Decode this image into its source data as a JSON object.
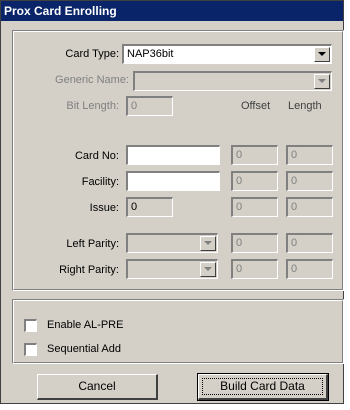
{
  "window": {
    "title": "Prox Card Enrolling"
  },
  "form": {
    "card_type": {
      "label": "Card Type:",
      "value": "NAP36bit"
    },
    "generic_name": {
      "label": "Generic Name:",
      "value": ""
    },
    "bit_length": {
      "label": "Bit Length:",
      "value": "0"
    },
    "columns": {
      "offset": "Offset",
      "length": "Length"
    },
    "rows": [
      {
        "label": "Card No:",
        "value": "",
        "offset": "0",
        "length": "0"
      },
      {
        "label": "Facility:",
        "value": "",
        "offset": "0",
        "length": "0"
      },
      {
        "label": "Issue:",
        "value": "0",
        "offset": "0",
        "length": "0"
      },
      {
        "label": "Left Parity:",
        "value": "",
        "offset": "0",
        "length": "0"
      },
      {
        "label": "Right Parity:",
        "value": "",
        "offset": "0",
        "length": "0"
      }
    ]
  },
  "options": {
    "enable_alpre": {
      "label": "Enable AL-PRE",
      "checked": false
    },
    "sequential_add": {
      "label": "Sequential Add",
      "checked": false
    }
  },
  "buttons": {
    "cancel": "Cancel",
    "build": "Build Card Data"
  },
  "colors": {
    "title_bg": "#0a246a",
    "face": "#d4d0c8",
    "disabled_text": "#808080"
  }
}
